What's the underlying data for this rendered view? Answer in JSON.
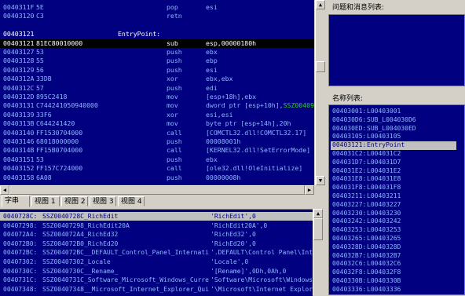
{
  "disassembly": {
    "rows": [
      {
        "addr": "0040311F",
        "bytes": "5E",
        "mnemonic": "pop",
        "operand": "esi"
      },
      {
        "addr": "00403120",
        "bytes": "C3",
        "mnemonic": "retn",
        "operand": ""
      },
      {
        "addr": "",
        "bytes": "",
        "mnemonic": "",
        "operand": ""
      },
      {
        "addr": "00403121",
        "bytes": "EntryPoint:",
        "mnemonic": "",
        "operand": "",
        "entry": true
      },
      {
        "addr": "00403121",
        "bytes": "81EC80010000",
        "mnemonic": "sub",
        "operand": "esp,00000180h",
        "selected": true
      },
      {
        "addr": "00403127",
        "bytes": "53",
        "mnemonic": "push",
        "operand": "ebx"
      },
      {
        "addr": "00403128",
        "bytes": "55",
        "mnemonic": "push",
        "operand": "ebp"
      },
      {
        "addr": "00403129",
        "bytes": "56",
        "mnemonic": "push",
        "operand": "esi"
      },
      {
        "addr": "0040312A",
        "bytes": "33DB",
        "mnemonic": "xor",
        "operand": "ebx,ebx"
      },
      {
        "addr": "0040312C",
        "bytes": "57",
        "mnemonic": "push",
        "operand": "edi"
      },
      {
        "addr": "0040312D",
        "bytes": "895C2418",
        "mnemonic": "mov",
        "operand": "[esp+18h],ebx"
      },
      {
        "addr": "00403131",
        "bytes": "C744241050940000",
        "mnemonic": "mov",
        "operand": "dword ptr [esp+10h],",
        "operand2": "SSZ004091SC_Error"
      },
      {
        "addr": "00403139",
        "bytes": "33F6",
        "mnemonic": "xor",
        "operand": "esi,esi"
      },
      {
        "addr": "0040313B",
        "bytes": "C644241420",
        "mnemonic": "mov",
        "operand": "byte ptr [esp+14h],20h"
      },
      {
        "addr": "00403140",
        "bytes": "FF1530704000",
        "mnemonic": "call",
        "operand": "[COMCTL32.dll!COMCTL32.17]"
      },
      {
        "addr": "00403146",
        "bytes": "68018000000",
        "mnemonic": "push",
        "operand": "00008001h"
      },
      {
        "addr": "0040314B",
        "bytes": "FF15B0704000",
        "mnemonic": "call",
        "operand": "[KERNEL32.dll!SetErrorMode]"
      },
      {
        "addr": "00403151",
        "bytes": "53",
        "mnemonic": "push",
        "operand": "ebx"
      },
      {
        "addr": "00403152",
        "bytes": "FF157C724000",
        "mnemonic": "call",
        "operand": "[ole32.dll!OleInitialize]"
      },
      {
        "addr": "00403158",
        "bytes": "6A08",
        "mnemonic": "push",
        "operand": "00000008h"
      }
    ]
  },
  "tabs": [
    "字串",
    "视图 1",
    "视图 2",
    "视图 3",
    "视图 4"
  ],
  "strings": {
    "rows": [
      {
        "addr": "0040728C:",
        "name": "SSZ0040728C_RichEdit",
        "value": "'RichEdit',0",
        "selected": true
      },
      {
        "addr": "00407298:",
        "name": "SSZ00407298_RichEdit20A",
        "value": "'RichEdit20A',0"
      },
      {
        "addr": "004072A4:",
        "name": "SSZ004072A4_RichEd32",
        "value": "'RichEd32',0"
      },
      {
        "addr": "004072B0:",
        "name": "SSZ004072B0_RichEd20",
        "value": "'RichEd20',0"
      },
      {
        "addr": "004072BC:",
        "name": "SSZ004072BC__DEFAULT_Control_Panel_Internati",
        "value": "'.DEFAULT\\Control Panel\\Internat"
      },
      {
        "addr": "00407302:",
        "name": "SSZ00407302_Locale",
        "value": "'Locale',0"
      },
      {
        "addr": "0040730C:",
        "name": "SSZ0040730C__Rename_",
        "value": "'[Rename]',0Dh,0Ah,0"
      },
      {
        "addr": "0040731C:",
        "name": "SSZ0040731C_Software_Microsoft_Windows_Curre",
        "value": "'Software\\Microsoft\\Windows\\Curr"
      },
      {
        "addr": "00407348:",
        "name": "SSZ00407348__Microsoft_Internet_Explorer_Qui",
        "value": "'\\Microsoft\\Internet Explorer\\Qu"
      }
    ]
  },
  "problems": {
    "title": "问题和消息列表:"
  },
  "names": {
    "title": "名称列表:",
    "rows": [
      {
        "addr": "00403001:",
        "label": "L00403001"
      },
      {
        "addr": "004030D6:",
        "label": "SUB_L004030D6"
      },
      {
        "addr": "004030ED:",
        "label": "SUB_L004030ED"
      },
      {
        "addr": "00403105:",
        "label": "L00403105"
      },
      {
        "addr": "00403121:",
        "label": "EntryPoint",
        "selected": true
      },
      {
        "addr": "004031C2:",
        "label": "L004031C2"
      },
      {
        "addr": "004031D7:",
        "label": "L004031D7"
      },
      {
        "addr": "004031E2:",
        "label": "L004031E2"
      },
      {
        "addr": "004031E8:",
        "label": "L004031E8"
      },
      {
        "addr": "004031F8:",
        "label": "L004031F8"
      },
      {
        "addr": "00403211:",
        "label": "L00403211"
      },
      {
        "addr": "00403227:",
        "label": "L00403227"
      },
      {
        "addr": "00403230:",
        "label": "L00403230"
      },
      {
        "addr": "00403242:",
        "label": "L00403242"
      },
      {
        "addr": "00403253:",
        "label": "L00403253"
      },
      {
        "addr": "00403265:",
        "label": "L00403265"
      },
      {
        "addr": "0040328D:",
        "label": "L0040328D"
      },
      {
        "addr": "004032B7:",
        "label": "L004032B7"
      },
      {
        "addr": "004032C6:",
        "label": "L004032C6"
      },
      {
        "addr": "004032F8:",
        "label": "L004032F8"
      },
      {
        "addr": "0040330B:",
        "label": "L0040330B"
      },
      {
        "addr": "00403336:",
        "label": "L00403336"
      }
    ]
  },
  "colors": {
    "pane_bg": "#000080",
    "text": "#8fb6ff",
    "selection": "#000000",
    "window": "#d4d0c8"
  }
}
